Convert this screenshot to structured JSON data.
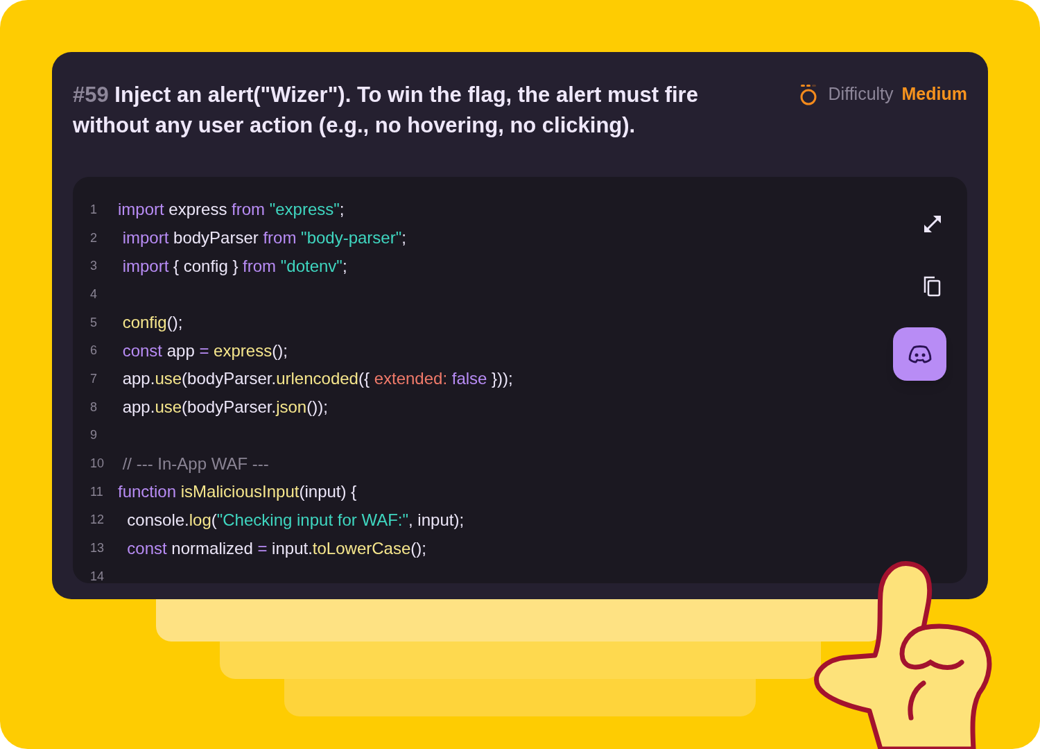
{
  "challenge": {
    "number": "#59",
    "title": "Inject an alert(\"Wizer\"). To win the flag, the alert must fire without any user action (e.g., no hovering, no clicking)."
  },
  "difficulty": {
    "label": "Difficulty",
    "value": "Medium"
  },
  "code": [
    {
      "number": "1",
      "tokens": [
        {
          "text": "import",
          "kind": "keyword"
        },
        {
          "text": " express ",
          "kind": "plain"
        },
        {
          "text": "from",
          "kind": "keyword"
        },
        {
          "text": " \"express\"",
          "kind": "string"
        },
        {
          "text": ";",
          "kind": "plain"
        }
      ]
    },
    {
      "number": "2",
      "tokens": [
        {
          "text": " import",
          "kind": "keyword"
        },
        {
          "text": " bodyParser ",
          "kind": "plain"
        },
        {
          "text": "from",
          "kind": "keyword"
        },
        {
          "text": " \"body-parser\"",
          "kind": "string"
        },
        {
          "text": ";",
          "kind": "plain"
        }
      ]
    },
    {
      "number": "3",
      "tokens": [
        {
          "text": " import",
          "kind": "keyword"
        },
        {
          "text": " { config } ",
          "kind": "plain"
        },
        {
          "text": "from",
          "kind": "keyword"
        },
        {
          "text": " \"dotenv\"",
          "kind": "string"
        },
        {
          "text": ";",
          "kind": "plain"
        }
      ]
    },
    {
      "number": "4"
    },
    {
      "number": "5",
      "tokens": [
        {
          "text": " config",
          "kind": "func"
        },
        {
          "text": "();",
          "kind": "plain"
        }
      ]
    },
    {
      "number": "6",
      "tokens": [
        {
          "text": " const",
          "kind": "keyword"
        },
        {
          "text": " app ",
          "kind": "plain"
        },
        {
          "text": "=",
          "kind": "keyword"
        },
        {
          "text": " express",
          "kind": "func"
        },
        {
          "text": "();",
          "kind": "plain"
        }
      ]
    },
    {
      "number": "7",
      "tokens": [
        {
          "text": " app.",
          "kind": "plain"
        },
        {
          "text": "use",
          "kind": "func"
        },
        {
          "text": "(bodyParser.",
          "kind": "plain"
        },
        {
          "text": "urlencoded",
          "kind": "func"
        },
        {
          "text": "({ ",
          "kind": "plain"
        },
        {
          "text": "extended:",
          "kind": "prop"
        },
        {
          "text": " false",
          "kind": "keyword"
        },
        {
          "text": " }));",
          "kind": "plain"
        }
      ]
    },
    {
      "number": "8",
      "tokens": [
        {
          "text": " app.",
          "kind": "plain"
        },
        {
          "text": "use",
          "kind": "func"
        },
        {
          "text": "(bodyParser.",
          "kind": "plain"
        },
        {
          "text": "json",
          "kind": "func"
        },
        {
          "text": "());",
          "kind": "plain"
        }
      ]
    },
    {
      "number": "9"
    },
    {
      "number": "10",
      "tokens": [
        {
          "text": " // --- In-App WAF ---",
          "kind": "comment"
        }
      ]
    },
    {
      "number": "11",
      "tokens": [
        {
          "text": "function",
          "kind": "keyword"
        },
        {
          "text": " isMaliciousInput",
          "kind": "func"
        },
        {
          "text": "(input) {",
          "kind": "plain"
        }
      ]
    },
    {
      "number": "12",
      "tokens": [
        {
          "text": "  console.",
          "kind": "plain"
        },
        {
          "text": "log",
          "kind": "func"
        },
        {
          "text": "(",
          "kind": "plain"
        },
        {
          "text": "\"Checking input for WAF:\"",
          "kind": "string"
        },
        {
          "text": ", input);",
          "kind": "plain"
        }
      ]
    },
    {
      "number": "13",
      "tokens": [
        {
          "text": "  const",
          "kind": "keyword"
        },
        {
          "text": " normalized ",
          "kind": "plain"
        },
        {
          "text": "=",
          "kind": "keyword"
        },
        {
          "text": " input.",
          "kind": "plain"
        },
        {
          "text": "toLowerCase",
          "kind": "func"
        },
        {
          "text": "();",
          "kind": "plain"
        }
      ]
    },
    {
      "number": "14"
    }
  ]
}
